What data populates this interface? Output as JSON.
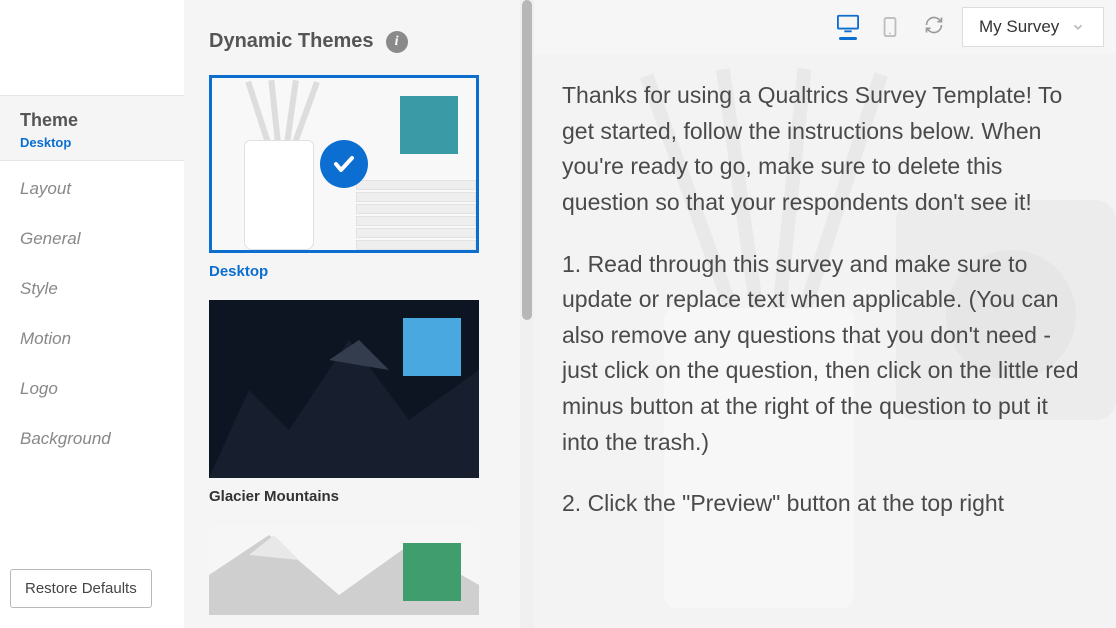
{
  "sidebar": {
    "active": {
      "title": "Theme",
      "sub": "Desktop"
    },
    "items": [
      "Layout",
      "General",
      "Style",
      "Motion",
      "Logo",
      "Background"
    ],
    "restore": "Restore Defaults"
  },
  "themes": {
    "heading": "Dynamic Themes",
    "cards": [
      {
        "label": "Desktop",
        "selected": true,
        "swatch": "#3a9ba6"
      },
      {
        "label": "Glacier Mountains",
        "selected": false,
        "swatch": "#4aa8e0"
      },
      {
        "label": "",
        "selected": false,
        "swatch": "#3f9d6e"
      }
    ]
  },
  "topbar": {
    "survey_label": "My Survey"
  },
  "preview": {
    "p1": "Thanks for using a Qualtrics Survey Template! To get started, follow the instructions below. When you're ready to go, make sure to delete this question so that your respondents don't see it!",
    "p2": "1. Read through this survey and make sure to update or replace text when applicable. (You can also remove any questions that you don't need - just click on the question, then click on the little red minus button at the right of the question to put it into the trash.)",
    "p3": "2. Click the \"Preview\" button at the top right"
  }
}
